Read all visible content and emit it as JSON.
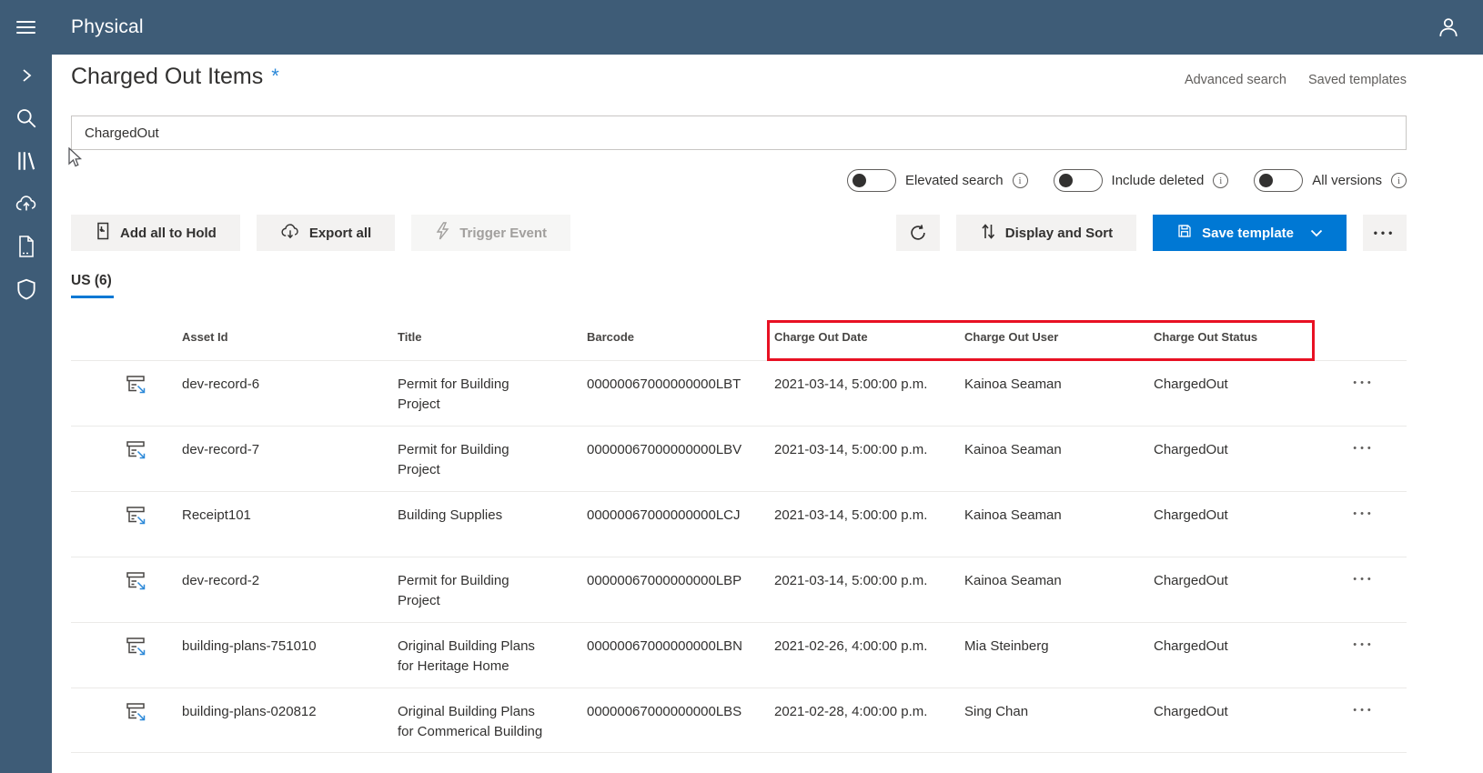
{
  "topbar": {
    "app_title": "Physical"
  },
  "page": {
    "title": "Charged Out Items",
    "unsaved_marker": "*",
    "advanced_search_label": "Advanced search",
    "saved_templates_label": "Saved templates"
  },
  "search": {
    "value": "ChargedOut"
  },
  "filters": {
    "elevated_search": "Elevated search",
    "include_deleted": "Include deleted",
    "all_versions": "All versions"
  },
  "toolbar": {
    "add_all_to_hold": "Add all to Hold",
    "export_all": "Export all",
    "trigger_event": "Trigger Event",
    "display_and_sort": "Display and Sort",
    "save_template": "Save template",
    "more": "•••"
  },
  "results": {
    "group_label": "US (6)"
  },
  "table": {
    "columns": {
      "asset_id": "Asset Id",
      "title": "Title",
      "barcode": "Barcode",
      "charge_out_date": "Charge Out Date",
      "charge_out_user": "Charge Out User",
      "charge_out_status": "Charge Out Status"
    },
    "row_more": "•••",
    "rows": [
      {
        "asset_id": "dev-record-6",
        "title": "Permit for Building Project",
        "barcode": "00000067000000000LBT",
        "charge_out_date": "2021-03-14, 5:00:00 p.m.",
        "charge_out_user": "Kainoa Seaman",
        "charge_out_status": "ChargedOut"
      },
      {
        "asset_id": "dev-record-7",
        "title": "Permit for Building Project",
        "barcode": "00000067000000000LBV",
        "charge_out_date": "2021-03-14, 5:00:00 p.m.",
        "charge_out_user": "Kainoa Seaman",
        "charge_out_status": "ChargedOut"
      },
      {
        "asset_id": "Receipt101",
        "title": "Building Supplies",
        "barcode": "00000067000000000LCJ",
        "charge_out_date": "2021-03-14, 5:00:00 p.m.",
        "charge_out_user": "Kainoa Seaman",
        "charge_out_status": "ChargedOut"
      },
      {
        "asset_id": "dev-record-2",
        "title": "Permit for Building Project",
        "barcode": "00000067000000000LBP",
        "charge_out_date": "2021-03-14, 5:00:00 p.m.",
        "charge_out_user": "Kainoa Seaman",
        "charge_out_status": "ChargedOut"
      },
      {
        "asset_id": "building-plans-751010",
        "title": "Original Building Plans for Heritage Home",
        "barcode": "00000067000000000LBN",
        "charge_out_date": "2021-02-26, 4:00:00 p.m.",
        "charge_out_user": "Mia Steinberg",
        "charge_out_status": "ChargedOut"
      },
      {
        "asset_id": "building-plans-020812",
        "title": "Original Building Plans for Commerical Building",
        "barcode": "00000067000000000LBS",
        "charge_out_date": "2021-02-28, 4:00:00 p.m.",
        "charge_out_user": "Sing Chan",
        "charge_out_status": "ChargedOut"
      }
    ]
  },
  "colors": {
    "topbar_background": "#3e5c77",
    "accent_blue": "#0078d4",
    "highlight_red": "#e81123"
  }
}
